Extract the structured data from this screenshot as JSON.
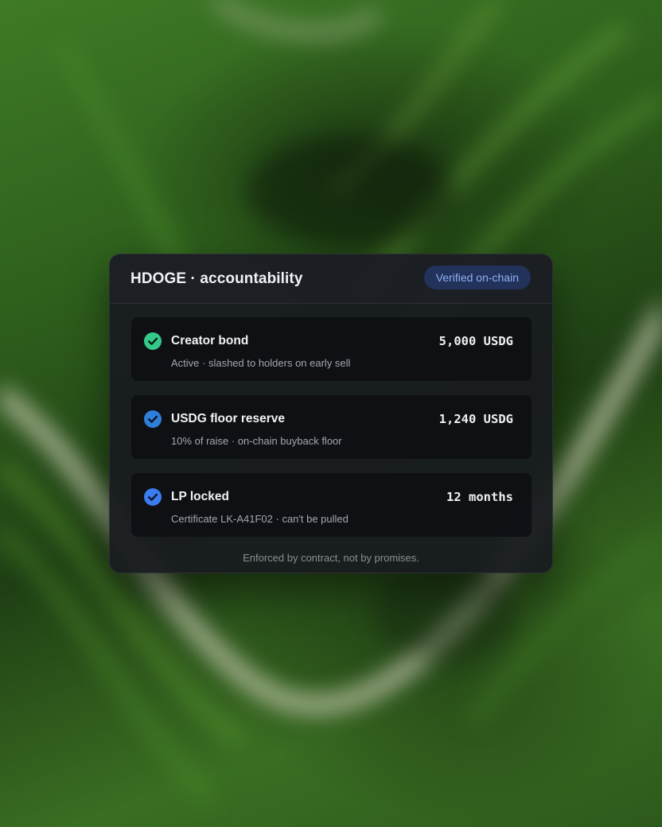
{
  "card": {
    "title": "HDOGE · accountability",
    "badge": "Verified on-chain",
    "footnote": "Enforced by contract, not by promises."
  },
  "rows": [
    {
      "name": "Creator bond",
      "subtitle": "Active · slashed to holders on early sell",
      "value": "5,000 USDG",
      "icon": "check-circle-icon",
      "icon_color": "#34c98b"
    },
    {
      "name": "USDG floor reserve",
      "subtitle": "10% of raise · on-chain buyback floor",
      "value": "1,240 USDG",
      "icon": "check-circle-icon",
      "icon_color": "#2d7fd9"
    },
    {
      "name": "LP locked",
      "subtitle": "Certificate LK-A41F02 · can't be pulled",
      "value": "12 months",
      "icon": "check-circle-icon",
      "icon_color": "#3b7cf0"
    }
  ],
  "colors": {
    "card_background": "#181a1f",
    "badge_background": "#22325a",
    "badge_text": "#8fb0f2",
    "row_background": "#0c0e12"
  }
}
